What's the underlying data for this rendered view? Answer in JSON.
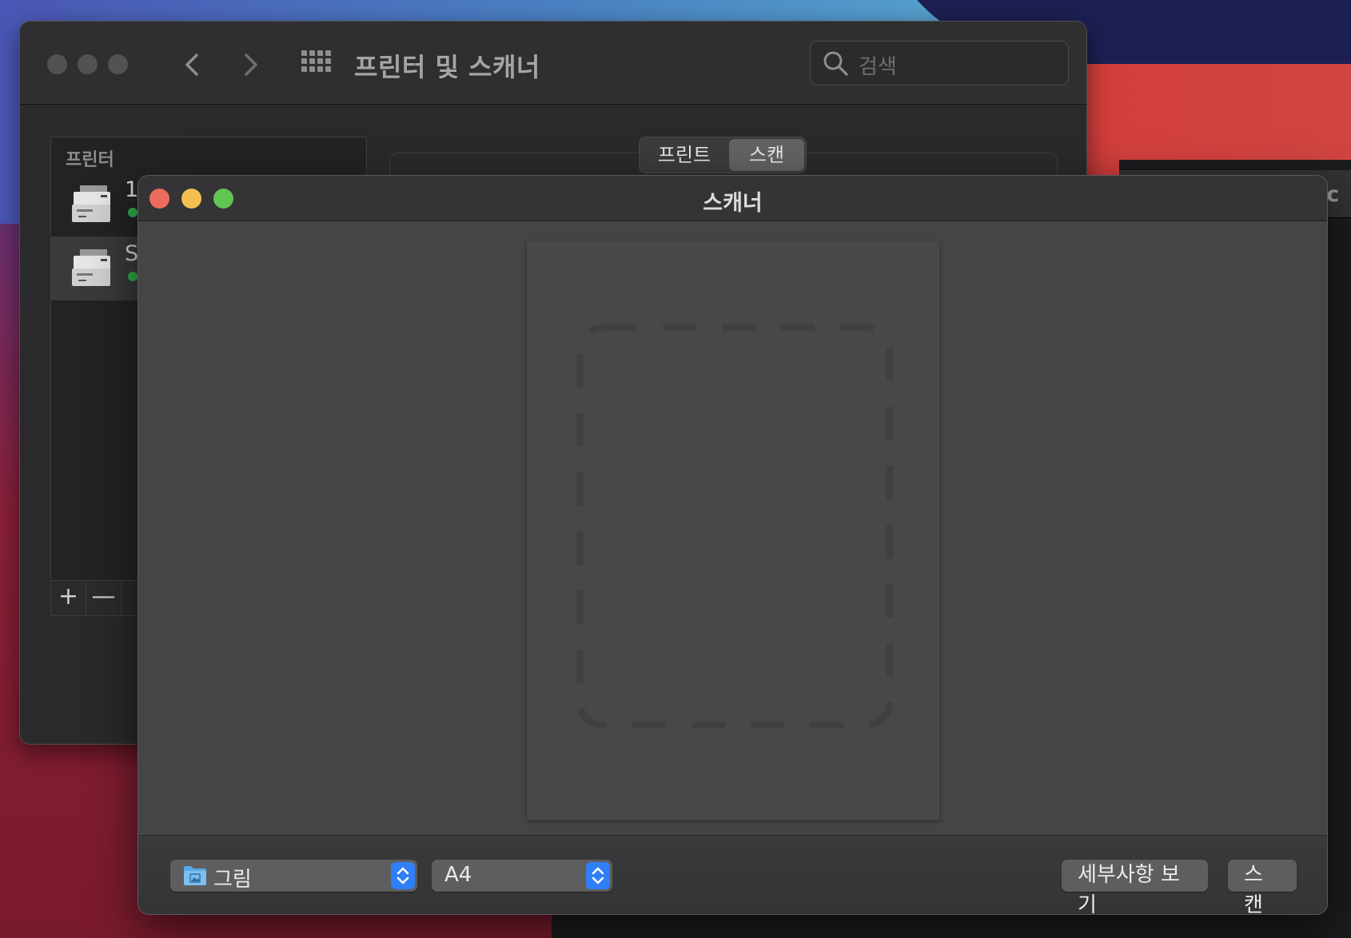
{
  "desktop": {
    "peek_window_fragment": "ic"
  },
  "prefs_window": {
    "title": "프린터 및 스캐너",
    "search_placeholder": "검색",
    "printers_header": "프린터",
    "printers": [
      {
        "name": "19",
        "status_color": "#30b14c"
      },
      {
        "name": "S",
        "status_color": "#30b14c"
      }
    ],
    "add_label": "+",
    "remove_label": "—",
    "tabs": [
      {
        "label": "프린트",
        "active": false
      },
      {
        "label": "스캔",
        "active": true
      }
    ],
    "icons": {
      "back": "chevron-left-icon",
      "forward": "chevron-right-icon",
      "grid": "grid-icon",
      "search": "search-icon",
      "printer": "printer-icon"
    }
  },
  "scanner_window": {
    "title": "스캐너",
    "destination": {
      "label": "그림",
      "icon": "folder-icon"
    },
    "paper_size": {
      "label": "A4"
    },
    "show_details_label": "세부사항 보기",
    "scan_label": "스캔",
    "accent_color": "#2f7ff7"
  }
}
